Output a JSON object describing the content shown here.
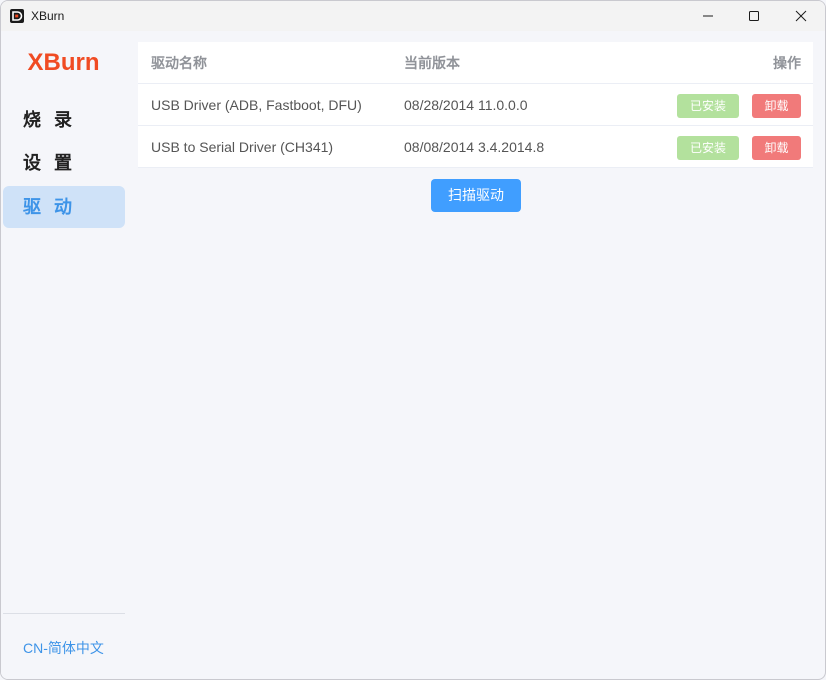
{
  "window": {
    "title": "XBurn"
  },
  "sidebar": {
    "brand": "XBurn",
    "items": [
      {
        "label": "烧 录",
        "active": false
      },
      {
        "label": "设 置",
        "active": false
      },
      {
        "label": "驱 动",
        "active": true
      }
    ],
    "language": "CN-简体中文"
  },
  "table": {
    "headers": {
      "name": "驱动名称",
      "version": "当前版本",
      "action": "操作"
    },
    "rows": [
      {
        "name": "USB Driver (ADB, Fastboot, DFU)",
        "version": "08/28/2014 11.0.0.0",
        "status_label": "已安装",
        "uninstall_label": "卸载"
      },
      {
        "name": "USB to Serial Driver (CH341)",
        "version": "08/08/2014 3.4.2014.8",
        "status_label": "已安装",
        "uninstall_label": "卸载"
      }
    ]
  },
  "scan_button": "扫描驱动",
  "colors": {
    "brand": "#f04b23",
    "accent": "#409eff",
    "installed": "#b3e19d",
    "uninstall": "#f17a7a",
    "active_nav_bg": "#cfe2f8"
  },
  "icons": {
    "app": "xburn-logo-icon",
    "minimize": "minimize-icon",
    "maximize": "maximize-icon",
    "close": "close-icon"
  }
}
